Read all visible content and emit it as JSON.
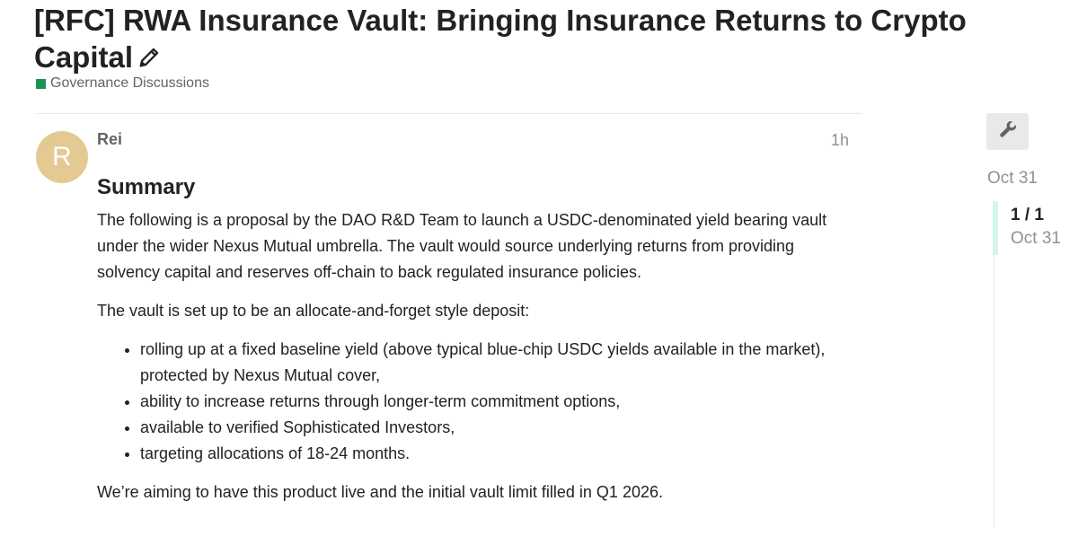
{
  "topic": {
    "title": "[RFC] RWA Insurance Vault: Bringing Insurance Returns to Crypto Capital",
    "edit_icon": "pencil-icon",
    "category": {
      "name": "Governance Discussions",
      "color": "#1a9155"
    }
  },
  "post": {
    "author": {
      "name": "Rei",
      "avatar_letter": "R",
      "avatar_color": "#e5c993"
    },
    "time": "1h",
    "heading": "Summary",
    "paragraphs": [
      "The following is a proposal by the DAO R&D Team to launch a USDC-denominated yield bearing vault under the wider Nexus Mutual umbrella. The vault would source underlying returns from providing solvency capital and reserves off-chain to back regulated insurance policies.",
      "The vault is set up to be an allocate-and-forget style deposit:"
    ],
    "bullets": [
      "rolling up at a fixed baseline yield (above typical blue-chip USDC yields available in the market), protected by Nexus Mutual cover,",
      "ability to increase returns through longer-term commitment options,",
      "available to verified Sophisticated Investors,",
      "targeting allocations of 18-24 months."
    ],
    "closing": "We’re aiming to have this product live and the initial vault limit filled in Q1 2026."
  },
  "timeline": {
    "admin_icon": "wrench-icon",
    "start_date": "Oct 31",
    "counter": "1 / 1",
    "current_date": "Oct 31",
    "accent": "#d4f7ea"
  }
}
